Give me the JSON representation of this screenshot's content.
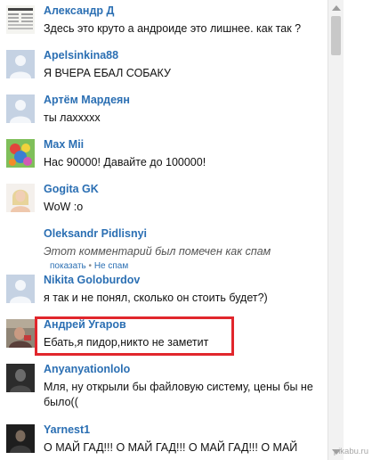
{
  "comments": [
    {
      "author": "Александр Д",
      "text": "Здесь это круто а андроиде это лишнее. как так ?",
      "avatar": "newspaper-avatar"
    },
    {
      "author": "Apelsinkina88",
      "text": "Я ВЧЕРА ЕБАЛ СОБАКУ",
      "avatar": "default-avatar"
    },
    {
      "author": "Артём Мардеян",
      "text": "ты лаххххх",
      "avatar": "default-avatar"
    },
    {
      "author": "Max Mii",
      "text": "Нас 90000! Давайте до 100000!",
      "avatar": "cartoon-avatar"
    },
    {
      "author": "Gogita GK",
      "text": "WoW :o",
      "avatar": "photo-avatar"
    },
    {
      "author": "Oleksandr Pidlisnyi",
      "text": "Этот комментарий был помечен как спам",
      "avatar": "none",
      "actions": {
        "show": "показать",
        "separator": "•",
        "not_spam": "Не спам"
      }
    },
    {
      "author": "Nikita Goloburdov",
      "text": "я так и не понял, сколько он стоить будет?)",
      "avatar": "default-avatar"
    },
    {
      "author": "Андрей Угаров",
      "text": "Ебать,я пидор,никто не заметит",
      "avatar": "photo-avatar"
    },
    {
      "author": "Anyanyationlolo",
      "text": "Мля, ну открыли бы файловую систему, цены бы не было((",
      "avatar": "dark-photo-avatar"
    },
    {
      "author": "Yarnest1",
      "text": "О МАЙ ГАД!!! О МАЙ ГАД!!! О МАЙ ГАД!!! О МАЙ",
      "avatar": "dark-photo-avatar"
    }
  ],
  "watermark": "pikabu.ru",
  "colors": {
    "author_link": "#2b6fb3",
    "highlight_border": "#e1262c",
    "default_avatar_bg": "#c5d2e3"
  }
}
